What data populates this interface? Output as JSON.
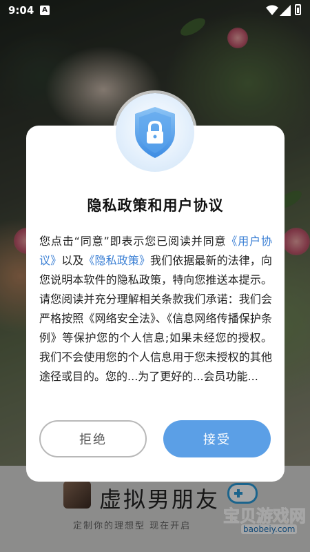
{
  "status_bar": {
    "time": "9:04",
    "notification_icon": "A"
  },
  "dialog": {
    "title": "隐私政策和用户协议",
    "body": {
      "part1": "您点击“同意”即表示您已阅读并同意",
      "link_user_agreement": "《用户协议》",
      "part2": "以及",
      "link_privacy_policy": "《隐私政策》",
      "part3": "我们依据最新的法律，向您说明本软件的隐私政策，特向您推送本提示。请您阅读并充分理解相关条款我们承诺：我们会严格按照《网络安全法》、《信息网络传播保护条例》等保护您的个人信息;如果未经您的授权。我们不会使用您的个人信息用于您未授权的其他途径或目的。",
      "part4": "您的...为了更好的...会员功能..."
    },
    "reject_label": "拒绝",
    "accept_label": "接受",
    "icon": "shield-lock-icon"
  },
  "background_app": {
    "app_name": "虚拟男朋友",
    "slogan": "定制你的理想型  现在开启"
  },
  "watermark": {
    "text": "宝贝游戏网",
    "url": "baobeiy.com"
  },
  "colors": {
    "accent": "#5b9fe6",
    "link": "#3a7fd4"
  }
}
